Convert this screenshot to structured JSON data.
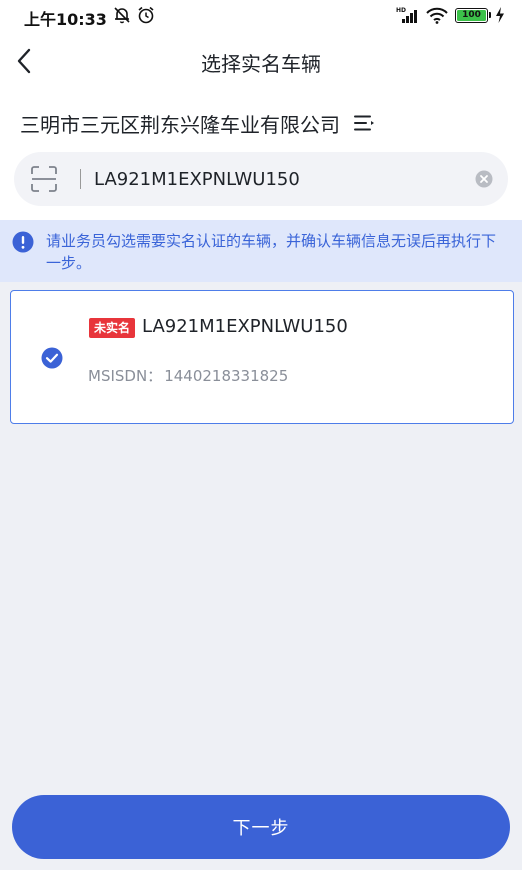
{
  "status_bar": {
    "time": "上午10:33",
    "battery_level": "100"
  },
  "nav": {
    "title": "选择实名车辆"
  },
  "company": {
    "name": "三明市三元区荆东兴隆车业有限公司"
  },
  "search": {
    "value": "LA921M1EXPNLWU150"
  },
  "notice": {
    "text": "请业务员勾选需要实名认证的车辆，并确认车辆信息无误后再执行下一步。"
  },
  "vehicles": [
    {
      "badge": "未实名",
      "vin": "LA921M1EXPNLWU150",
      "msisdn_label": "MSISDN：",
      "msisdn": "1440218331825",
      "checked": true
    }
  ],
  "footer": {
    "next_label": "下一步"
  },
  "colors": {
    "primary": "#3b62d6",
    "badge": "#e8353b",
    "notice_bg": "#dfe7fb",
    "notice_text": "#3a64d8",
    "page_bg": "#eef0f5"
  }
}
